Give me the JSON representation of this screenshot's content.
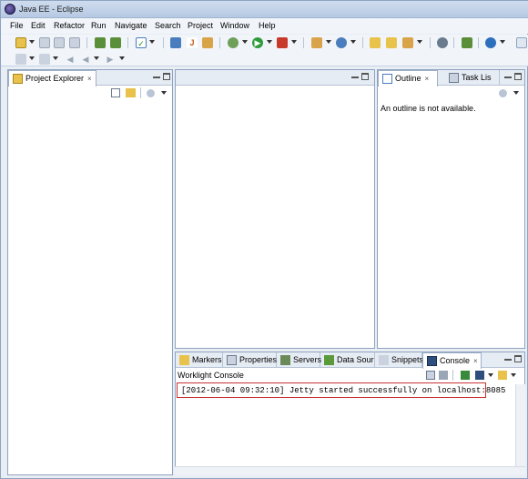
{
  "window": {
    "title": "Java EE - Eclipse"
  },
  "menu": [
    "File",
    "Edit",
    "Refactor",
    "Run",
    "Navigate",
    "Search",
    "Project",
    "Window",
    "Help"
  ],
  "icons": {
    "app": "eclipse-logo-icon",
    "toolbar1": [
      "new-icon",
      "save-icon",
      "save-all-icon",
      "print-icon",
      "open-type-icon",
      "open-resource-icon",
      "check-icon",
      "open-java-icon",
      "jsp-icon",
      "jar-icon",
      "debug-icon",
      "run-icon",
      "profile-icon",
      "external-tools-icon",
      "new-server-icon",
      "folder-icon",
      "open-folder-icon",
      "pen-icon",
      "globe-icon",
      "search-icon",
      "web-browser-icon",
      "perspective-icon"
    ],
    "toolbar2": [
      "next-annotation-icon",
      "prev-annotation-icon",
      "back-icon",
      "forward-icon",
      "last-edit-icon"
    ]
  },
  "project_explorer": {
    "tab_label": "Project Explorer",
    "tab_close": "×"
  },
  "outline": {
    "tabs": [
      {
        "label": "Outline",
        "close": "×",
        "icon": "outline-icon"
      },
      {
        "label": "Task Lis",
        "icon": "task-list-icon"
      }
    ],
    "message": "An outline is not available."
  },
  "bottom": {
    "tabs": [
      {
        "label": "Markers",
        "icon": "markers-icon"
      },
      {
        "label": "Properties",
        "icon": "properties-icon"
      },
      {
        "label": "Servers",
        "icon": "servers-icon"
      },
      {
        "label": "Data Sour",
        "icon": "data-source-icon"
      },
      {
        "label": "Snippets",
        "icon": "snippets-icon"
      },
      {
        "label": "Console",
        "close": "×",
        "icon": "console-icon"
      }
    ],
    "console_name": "Worklight Console",
    "console_output": "[2012-06-04 09:32:10] Jetty started successfully on localhost:8085"
  }
}
